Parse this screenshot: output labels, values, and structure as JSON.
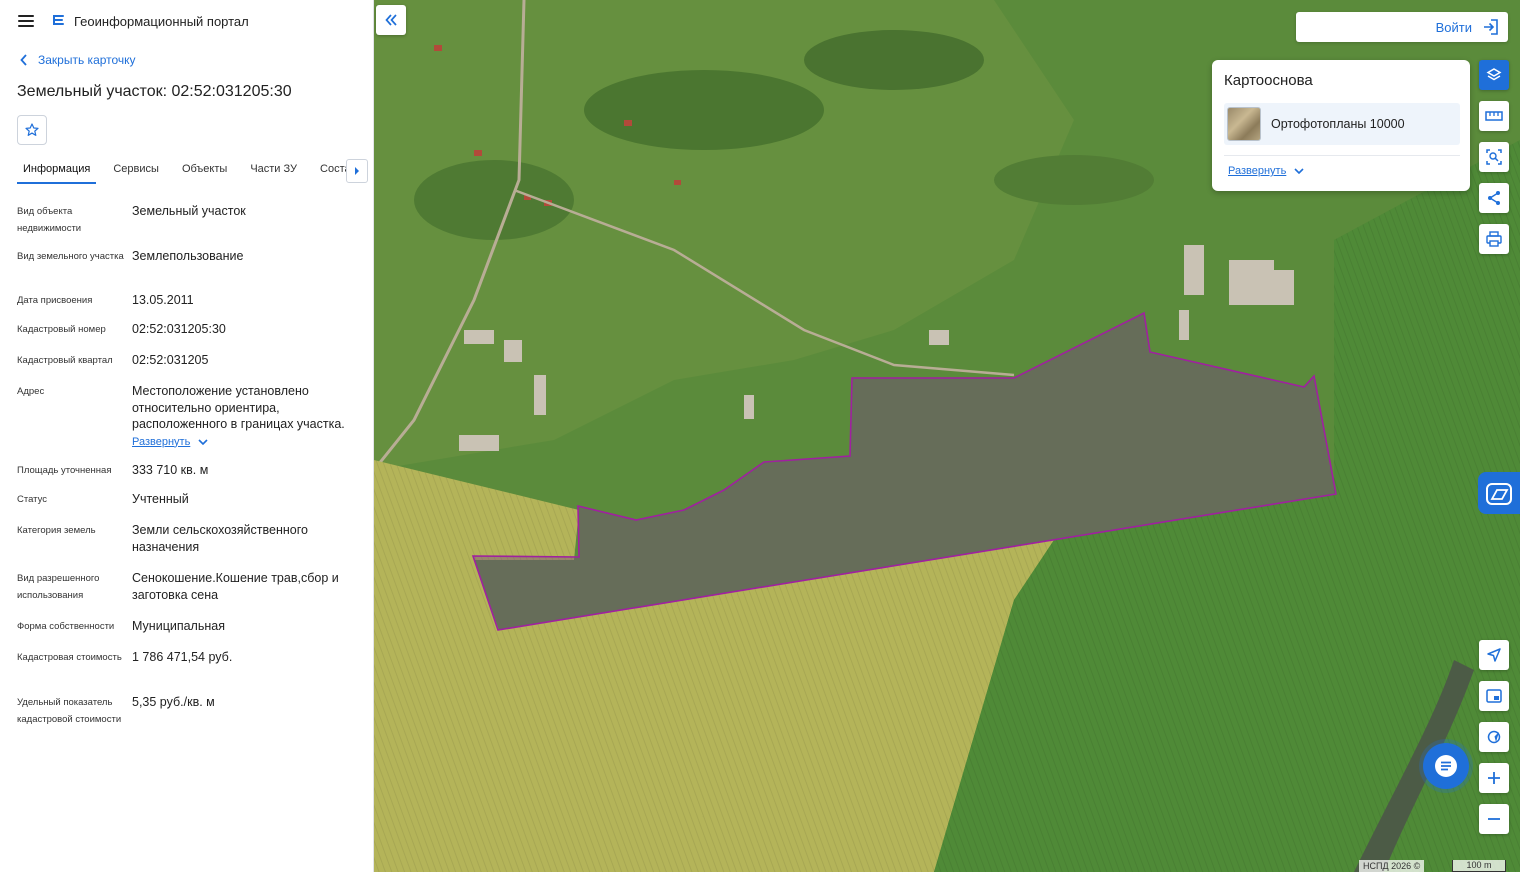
{
  "header": {
    "app_title": "Геоинформационный портал"
  },
  "card": {
    "close_label": "Закрыть карточку",
    "title": "Земельный участок: 02:52:031205:30",
    "tabs": [
      {
        "label": "Информация",
        "active": true
      },
      {
        "label": "Сервисы"
      },
      {
        "label": "Объекты"
      },
      {
        "label": "Части ЗУ"
      },
      {
        "label": "Состав"
      }
    ],
    "properties": [
      {
        "label": "Вид объекта недвижимости",
        "value": "Земельный участок"
      },
      {
        "label": "Вид земельного участка",
        "value": "Землепользование"
      },
      {
        "label": "Дата присвоения",
        "value": "13.05.2011"
      },
      {
        "label": "Кадастровый номер",
        "value": "02:52:031205:30"
      },
      {
        "label": "Кадастровый квартал",
        "value": "02:52:031205"
      },
      {
        "label": "Адрес",
        "value": "Местоположение установлено относительно ориентира, расположенного в границах участка.",
        "expand_label": "Развернуть"
      },
      {
        "label": "Площадь уточненная",
        "value": "333 710 кв. м"
      },
      {
        "label": "Статус",
        "value": "Учтенный"
      },
      {
        "label": "Категория земель",
        "value": "Земли сельскохозяйственного назначения"
      },
      {
        "label": "Вид разрешенного использования",
        "value": "Сенокошение.Кошение трав,сбор и заготовка сена"
      },
      {
        "label": "Форма собственности",
        "value": "Муниципальная"
      },
      {
        "label": "Кадастровая стоимость",
        "value": "1 786 471,54 руб."
      },
      {
        "label": "Удельный показатель кадастровой стоимости",
        "value": "5,35 руб./кв. м"
      }
    ]
  },
  "map": {
    "login_label": "Войти",
    "basemap": {
      "title": "Картооснова",
      "selected": "Ортофотопланы 10000",
      "expand_label": "Развернуть"
    },
    "copyright": "НСПД 2026 ©",
    "scale_label": "100 m",
    "parcel_outline_color": "#a020a0",
    "accent_color": "#1f6fd9",
    "tools_top": [
      "layers-icon",
      "ruler-icon",
      "select-area-icon",
      "share-icon",
      "print-icon"
    ],
    "tools_bottom": [
      "locate-icon",
      "minimap-icon",
      "geolocation-icon",
      "zoom-in-icon",
      "zoom-out-icon"
    ]
  }
}
